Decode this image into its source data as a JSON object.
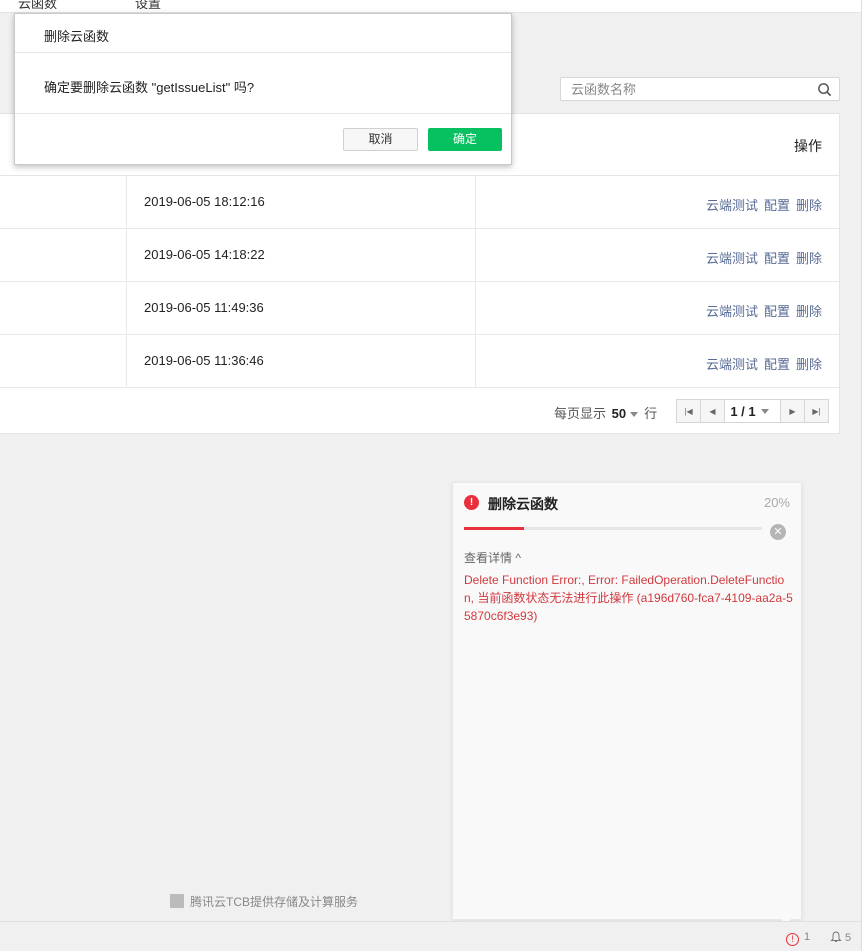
{
  "topbar": {
    "left_label": "云函数",
    "right_label": "设置"
  },
  "search": {
    "placeholder": "云函数名称"
  },
  "table": {
    "op_header": "操作",
    "rows": [
      {
        "time": "2019-06-05 18:12:16",
        "test": "云端测试",
        "config": "配置",
        "delete": "删除"
      },
      {
        "time": "2019-06-05 14:18:22",
        "test": "云端测试",
        "config": "配置",
        "delete": "删除"
      },
      {
        "time": "2019-06-05 11:49:36",
        "test": "云端测试",
        "config": "配置",
        "delete": "删除"
      },
      {
        "time": "2019-06-05 11:36:46",
        "test": "云端测试",
        "config": "配置",
        "delete": "删除"
      }
    ]
  },
  "pager": {
    "per_page_label": "每页显示",
    "per_page_value": "50",
    "row_label": "行",
    "page": "1 / 1"
  },
  "dialog": {
    "title": "删除云函数",
    "message": "确定要删除云函数 \"getIssueList\" 吗?",
    "cancel": "取消",
    "confirm": "确定"
  },
  "progress_panel": {
    "title": "删除云函数",
    "percent_text": "20%",
    "progress": 0.2,
    "details_toggle": "查看详情 ^",
    "error": "Delete Function Error:, Error: FailedOperation.DeleteFunction, 当前函数状态无法进行此操作 (a196d760-fca7-4109-aa2a-55870c6f3e93)"
  },
  "footer": {
    "text": "腾讯云TCB提供存储及计算服务"
  },
  "statusbar": {
    "warnings": "1",
    "notifications": "5"
  },
  "colors": {
    "primary": "#07c160",
    "error": "#e8303c",
    "link": "#576b95"
  }
}
